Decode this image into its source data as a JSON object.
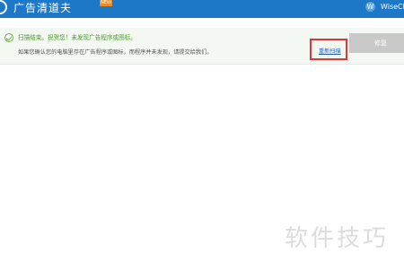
{
  "app": {
    "title": "广告清道夫",
    "badge": "NEW",
    "brand_letter": "W",
    "brand_name": "WiseCle"
  },
  "result": {
    "title": "扫描结束。祝贺您！未发现广告程序或图标。",
    "description": "如果您确认您的电脑里存在广告程序或图标，而程序并未发现，请提交给我们。",
    "rescan_label": "重新扫描",
    "repair_label": "修复"
  },
  "watermark": {
    "text": "软件技巧"
  },
  "colors": {
    "titlebar": "#1e78c8",
    "result_green": "#4f9a2c",
    "link_blue": "#2a5fb0",
    "highlight_red": "#d83a3a",
    "repair_disabled": "#c9c9c9"
  }
}
